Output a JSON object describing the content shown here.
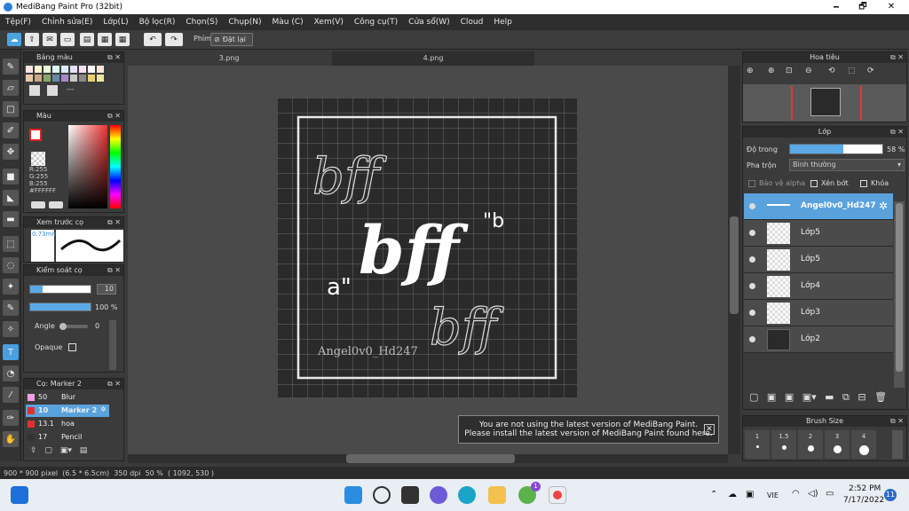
{
  "window": {
    "title": "MediBang Paint Pro (32bit)",
    "minimize": "🗕",
    "maximize": "🗗",
    "close": "✕"
  },
  "menu": [
    "Tệp(F)",
    "Chỉnh sửa(E)",
    "Lớp(L)",
    "Bộ lọc(R)",
    "Chọn(S)",
    "Chụp(N)",
    "Màu (C)",
    "Xem(V)",
    "Công cụ(T)",
    "Cửa sổ(W)",
    "Cloud",
    "Help"
  ],
  "toolbar": {
    "phim_label": "Phím",
    "reset_label": "Đặt lại"
  },
  "tabs": [
    "3.png",
    "4.png"
  ],
  "panels": {
    "palette": {
      "title": "Bảng màu",
      "dash": "---"
    },
    "color": {
      "title": "Màu",
      "r": "R:255",
      "g": "G:255",
      "b": "B:255",
      "hex": "#FFFFFF"
    },
    "brush_preview": {
      "title": "Xem trước cọ",
      "size": "0.73mm"
    },
    "brush_control": {
      "title": "Kiểm soát cọ",
      "size_value": "10",
      "opacity_value": "100 %",
      "opacity_fill": 1.0,
      "angle_label": "Angle",
      "angle_value": "0",
      "opaque_label": "Opaque"
    },
    "brush_list": {
      "title": "Cọ: Marker 2",
      "items": [
        {
          "size": "50",
          "name": "Blur",
          "color": "#f0a0e0"
        },
        {
          "size": "10",
          "name": "Marker 2",
          "color": "#e03030",
          "selected": true
        },
        {
          "size": "13.1",
          "name": "hoa",
          "color": "#e03030"
        },
        {
          "size": "17",
          "name": "Pencil",
          "color": "#333333"
        }
      ]
    },
    "navigator": {
      "title": "Hoa tiêu"
    },
    "layer": {
      "title": "Lớp",
      "opacity_label": "Độ trong",
      "opacity_value": "58 %",
      "opacity_fill": 0.58,
      "blend_label": "Pha trộn",
      "blend_value": "Bình thường",
      "protect_alpha": "Bảo vệ alpha",
      "clip": "Xén bớt",
      "lock": "Khóa",
      "layers": [
        {
          "name": "Angel0v0_Hd247",
          "selected": true
        },
        {
          "name": "Lớp5"
        },
        {
          "name": "Lớp5"
        },
        {
          "name": "Lớp4"
        },
        {
          "name": "Lớp3"
        },
        {
          "name": "Lớp2"
        }
      ]
    },
    "brush_size": {
      "title": "Brush Size",
      "sizes": [
        "1",
        "1.5",
        "2",
        "3",
        "4"
      ]
    }
  },
  "canvas": {
    "watermark": "Angel0v0_Hd247",
    "main_text": "bff"
  },
  "notice": {
    "line1": "You are not using the latest version of MediBang Paint.",
    "line2": "Please install the latest version of MediBang Paint found here."
  },
  "status": {
    "size": "900 * 900 pixel",
    "cm": "(6.5 * 6.5cm)",
    "dpi": "350 dpi",
    "zoom": "50 %",
    "coords": "( 1092, 530 )"
  },
  "taskbar": {
    "lang": "VIE",
    "time": "2:52 PM",
    "date": "7/17/2022",
    "notif": "11",
    "badge": "1"
  },
  "colors": {
    "accent": "#5aa2dc",
    "panel": "#3b3b3b",
    "canvas_bg": "#2a2a2a"
  }
}
